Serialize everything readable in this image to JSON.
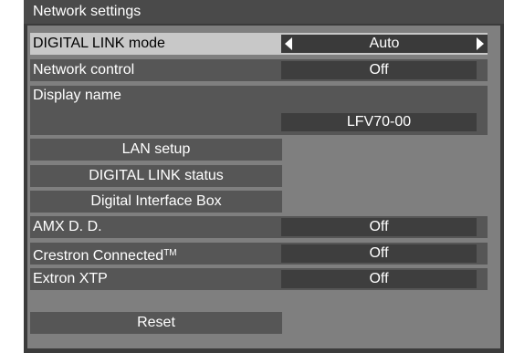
{
  "title": "Network settings",
  "rows": {
    "digital_link_mode": {
      "label": "DIGITAL LINK mode",
      "value": "Auto"
    },
    "network_control": {
      "label": "Network control",
      "value": "Off"
    },
    "display_name": {
      "label": "Display name",
      "value": "LFV70-00"
    },
    "amx": {
      "label": "AMX D. D.",
      "value": "Off"
    },
    "crestron": {
      "label": "Crestron Connected",
      "tm": "TM",
      "value": "Off"
    },
    "extron": {
      "label": "Extron XTP",
      "value": "Off"
    }
  },
  "buttons": {
    "lan_setup": "LAN setup",
    "digital_link_status": "DIGITAL LINK status",
    "digital_interface_box": "Digital Interface Box",
    "reset": "Reset"
  },
  "icons": {
    "left_arrow": "left-arrow-icon",
    "right_arrow": "right-arrow-icon"
  },
  "colors": {
    "background": "#3b3b3b",
    "panel": "#7f7f7f",
    "row": "#565656",
    "selected_row": "#c8c8c8",
    "value_box": "#3e3e3e",
    "text": "#ffffff"
  }
}
